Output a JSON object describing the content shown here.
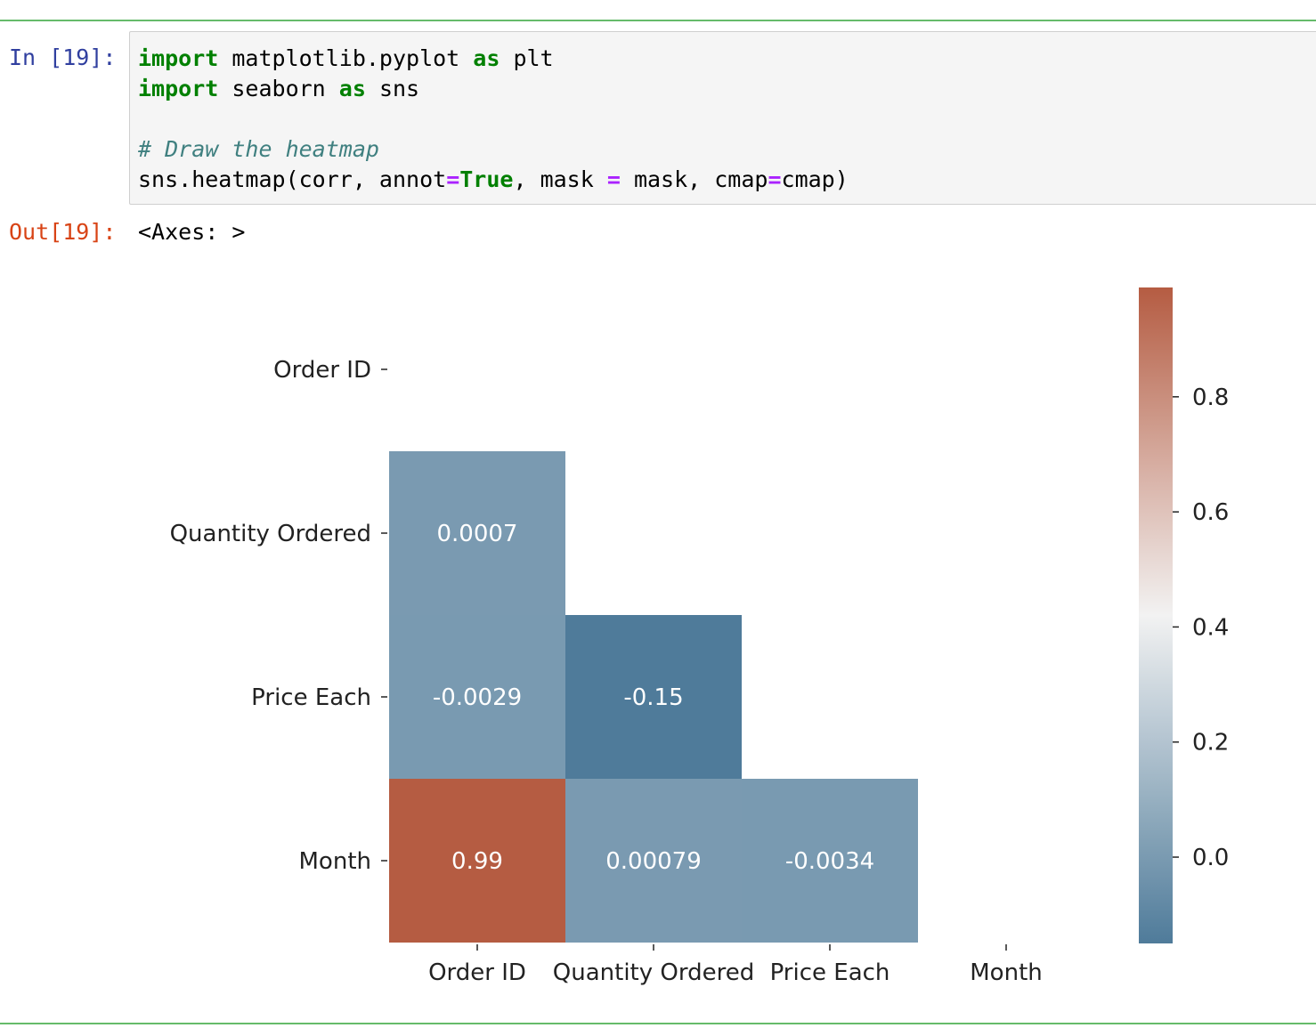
{
  "notebook": {
    "in_prompt": "In [19]:",
    "out_prompt": "Out[19]:",
    "output_text": "<Axes: >",
    "code": {
      "line1": {
        "kw1": "import",
        "mid": " matplotlib.pyplot ",
        "kw2": "as",
        "end": " plt"
      },
      "line2": {
        "kw1": "import",
        "mid": " seaborn ",
        "kw2": "as",
        "end": " sns"
      },
      "line3": {
        "comment": "# Draw the heatmap"
      },
      "line4": {
        "a": "sns.heatmap(corr, annot",
        "eq1": "=",
        "true": "True",
        "b": ", mask ",
        "eq2": "=",
        "c": " mask, cmap",
        "eq3": "=",
        "d": "cmap)"
      }
    }
  },
  "chart_data": {
    "type": "heatmap",
    "rows": [
      "Order ID",
      "Quantity Ordered",
      "Price Each",
      "Month"
    ],
    "columns": [
      "Order ID",
      "Quantity Ordered",
      "Price Each",
      "Month"
    ],
    "cells": [
      {
        "row": 1,
        "col": 0,
        "value": 0.0007,
        "label": "0.0007"
      },
      {
        "row": 2,
        "col": 0,
        "value": -0.0029,
        "label": "-0.0029"
      },
      {
        "row": 2,
        "col": 1,
        "value": -0.15,
        "label": "-0.15"
      },
      {
        "row": 3,
        "col": 0,
        "value": 0.99,
        "label": "0.99"
      },
      {
        "row": 3,
        "col": 1,
        "value": 0.00079,
        "label": "0.00079"
      },
      {
        "row": 3,
        "col": 2,
        "value": -0.0034,
        "label": "-0.0034"
      }
    ],
    "colorbar": {
      "range": [
        -0.15,
        0.99
      ],
      "ticks": [
        0.0,
        0.2,
        0.4,
        0.6,
        0.8
      ],
      "tick_labels": [
        "0.0",
        "0.2",
        "0.4",
        "0.6",
        "0.8"
      ],
      "low_color": "#4f7b9a",
      "mid_color": "#f2f2f2",
      "high_color": "#b55c42"
    }
  }
}
